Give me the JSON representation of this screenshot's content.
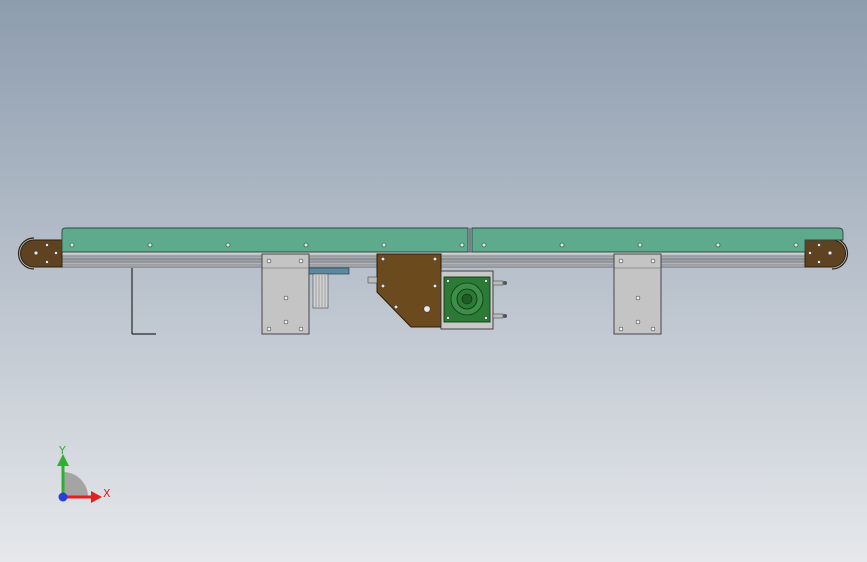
{
  "viewport": {
    "background_top": "#8d9cae",
    "background_bottom": "#e6e8eb"
  },
  "triad": {
    "y_label": "Y",
    "x_label": "X",
    "y_color": "#2fb12f",
    "x_color": "#e02121",
    "z_color": "#2b3fd6"
  },
  "model": {
    "belt_color": "#5daa8c",
    "frame_color": "#a8abae",
    "bracket_color": "#c4c4c4",
    "drive_plate_color": "#6b4a1e",
    "motor_color": "#2b7a35"
  }
}
